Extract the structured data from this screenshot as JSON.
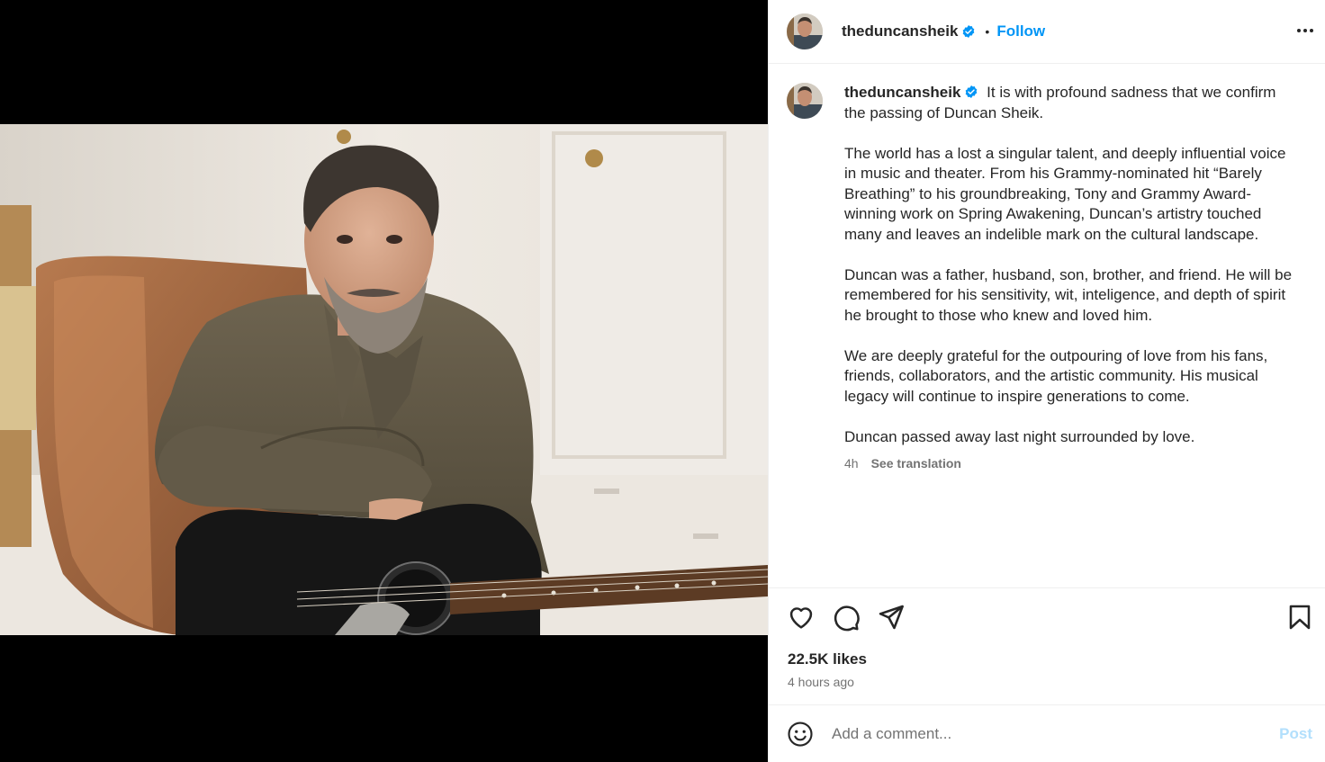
{
  "post": {
    "username": "theduncansheik",
    "follow_label": "Follow",
    "separator": "•",
    "caption_first": "It is with profound sadness that we confirm the passing of Duncan Sheik.",
    "caption_paragraphs": [
      "The world has a lost a singular talent, and deeply influential voice in music and theater. From his Grammy-nominated hit “Barely Breathing” to his groundbreaking, Tony and Grammy Award-winning work on Spring Awakening, Duncan’s artistry touched many and leaves an indelible mark on the cultural landscape.",
      "Duncan was a father, husband, son, brother, and friend. He will be remembered for his sensitivity, wit, inteligence, and depth of spirit he brought to those who knew and loved him.",
      "We are deeply grateful for the outpouring of love from his fans, friends, collaborators, and the artistic community. His musical legacy will continue to inspire generations to come.",
      "Duncan passed away last night surrounded by love."
    ],
    "caption_age": "4h",
    "see_translation": "See translation",
    "likes": "22.5K likes",
    "posted_ago": "4 hours ago"
  },
  "comment": {
    "placeholder": "Add a comment...",
    "post_label": "Post"
  },
  "icons": {
    "like": "heart-icon",
    "comment": "comment-icon",
    "share": "share-icon",
    "save": "bookmark-icon",
    "more": "more-options-icon",
    "emoji": "emoji-icon",
    "verified": "verified-badge-icon"
  },
  "colors": {
    "accent": "#0095f6",
    "post_disabled": "#b2dffc",
    "muted": "#737373"
  }
}
